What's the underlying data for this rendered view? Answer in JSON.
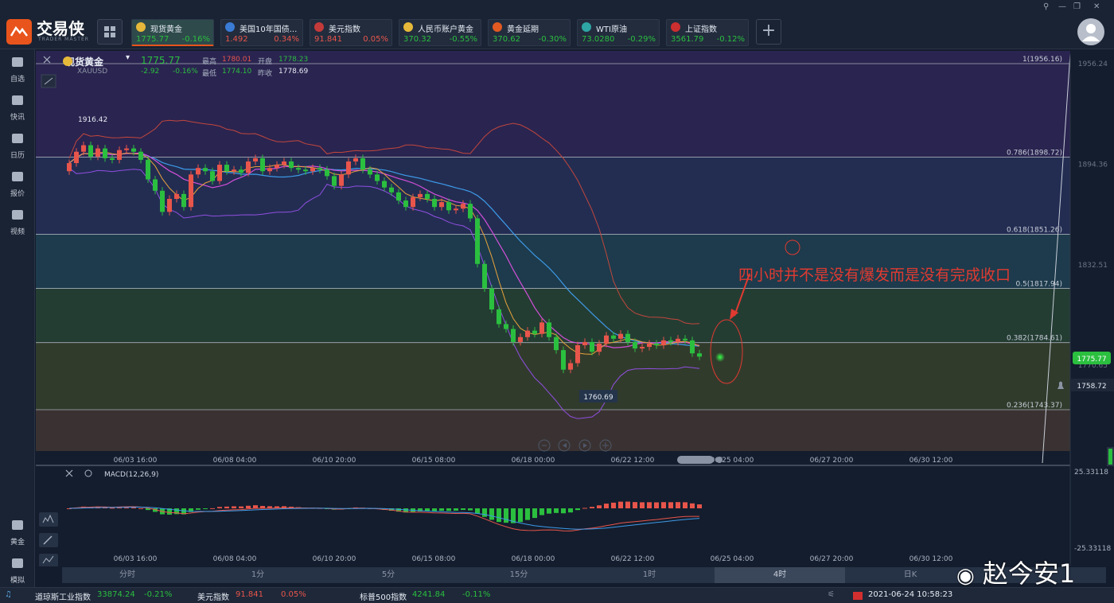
{
  "app": {
    "brand": "交易侠",
    "brand_sub": "TRADER MASTER",
    "win_ctl": [
      "⚲",
      "—",
      "❐",
      "✕"
    ],
    "add": "+"
  },
  "tiles": [
    {
      "name": "现货黄金",
      "price": "1775.77",
      "change": "-0.16%",
      "icon_color": "#e6b93a",
      "dir": "down",
      "active": true
    },
    {
      "name": "美国10年国债...",
      "price": "1.492",
      "change": "0.34%",
      "icon_color": "#3a7bd5",
      "dir": "up"
    },
    {
      "name": "美元指数",
      "price": "91.841",
      "change": "0.05%",
      "icon_color": "#c33a3a",
      "dir": "up"
    },
    {
      "name": "人民币账户黄金",
      "price": "370.32",
      "change": "-0.55%",
      "icon_color": "#e6b93a",
      "dir": "down"
    },
    {
      "name": "黄金延期",
      "price": "370.62",
      "change": "-0.30%",
      "icon_color": "#e25a22",
      "dir": "down"
    },
    {
      "name": "WTI原油",
      "price": "73.0280",
      "change": "-0.29%",
      "icon_color": "#2fa6a6",
      "dir": "down"
    },
    {
      "name": "上证指数",
      "price": "3561.79",
      "change": "-0.12%",
      "icon_color": "#cc2f2f",
      "dir": "down"
    }
  ],
  "sidebar": [
    {
      "label": "自选"
    },
    {
      "label": "快讯"
    },
    {
      "label": "日历"
    },
    {
      "label": "报价"
    },
    {
      "label": "视频"
    },
    {
      "label": "黄金"
    },
    {
      "label": "模拟"
    }
  ],
  "symbol": {
    "name": "现货黄金",
    "code": "XAUUSD",
    "price": "1775.77",
    "chg": "-2.92",
    "pct": "-0.16%",
    "high_label": "最高",
    "high": "1780.01",
    "open_label": "开盘",
    "open": "1778.23",
    "low_label": "最低",
    "low": "1774.10",
    "prev_label": "昨收",
    "prev": "1778.69"
  },
  "colors": {
    "up": "#e8554b",
    "down": "#2bbf3f",
    "accent": "#e8541c"
  },
  "chart_data": {
    "type": "candlestick",
    "x_ticks": [
      "06/03 16:00",
      "06/08 04:00",
      "06/10 20:00",
      "06/15 08:00",
      "06/18 00:00",
      "06/22 12:00",
      "06/25 04:00",
      "06/27 20:00",
      "06/30 12:00"
    ],
    "y_right_labels": [
      "1956.24",
      "1894.36",
      "1832.51",
      "1770.65"
    ],
    "fib_levels": [
      {
        "label": "1(1956.16)",
        "value": 1956.16
      },
      {
        "label": "0.786(1898.72)",
        "value": 1898.72
      },
      {
        "label": "0.618(1851.26)",
        "value": 1851.26
      },
      {
        "label": "0.5(1817.94)",
        "value": 1817.94
      },
      {
        "label": "0.382(1784.61)",
        "value": 1784.61
      },
      {
        "label": "0.236(1743.37)",
        "value": 1743.37
      }
    ],
    "high_marker": "1916.42",
    "low_marker": "1760.69",
    "current_price": "1775.77",
    "alert_price": "1758.72",
    "macd_label": "MACD(12,26,9)",
    "macd_top": "25.33118",
    "macd_bottom": "-25.33118",
    "closes": [
      1895,
      1902,
      1906,
      1899,
      1904,
      1898,
      1897,
      1903,
      1904,
      1902,
      1897,
      1885,
      1878,
      1865,
      1873,
      1876,
      1868,
      1888,
      1892,
      1890,
      1884,
      1894,
      1890,
      1891,
      1889,
      1896,
      1898,
      1890,
      1892,
      1894,
      1896,
      1892,
      1891,
      1890,
      1892,
      1891,
      1887,
      1881,
      1888,
      1896,
      1898,
      1891,
      1888,
      1884,
      1880,
      1877,
      1872,
      1868,
      1874,
      1876,
      1873,
      1868,
      1871,
      1866,
      1867,
      1870,
      1861,
      1833,
      1818,
      1805,
      1796,
      1793,
      1785,
      1788,
      1792,
      1790,
      1797,
      1788,
      1780,
      1768,
      1772,
      1783,
      1785,
      1779,
      1784,
      1789,
      1787,
      1790,
      1785,
      1781,
      1782,
      1784,
      1783,
      1786,
      1785,
      1787,
      1786,
      1778,
      1776
    ]
  },
  "annotation": "四小时并不是没有爆发而是没有完成收口",
  "timeframes": [
    "分时",
    "1分",
    "5分",
    "15分",
    "1时",
    "4时",
    "日K"
  ],
  "active_timeframe": "4时",
  "status": {
    "dow_label": "道琼斯工业指数",
    "dow": "33874.24",
    "dow_pct": "-0.21%",
    "usd_label": "美元指数",
    "usd": "91.841",
    "usd_pct": "0.05%",
    "sp_label": "标普500指数",
    "sp": "4241.84",
    "sp_pct": "-0.11%",
    "datetime": "2021-06-24 10:58:23"
  },
  "watermark": "赵今安1"
}
